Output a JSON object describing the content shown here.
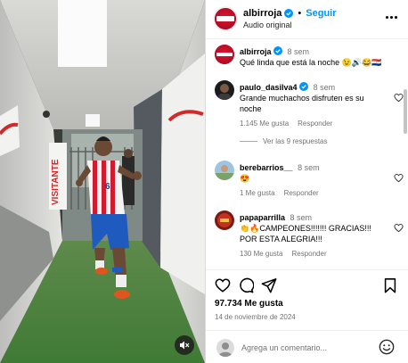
{
  "colors": {
    "accent": "#0095f6",
    "brand": "#c8102e",
    "muted": "#737373"
  },
  "header": {
    "username": "albirroja",
    "follow_label": "Seguir",
    "subtitle": "Audio original",
    "more_icon": "more-horizontal-icon"
  },
  "caption": {
    "username": "albirroja",
    "time": "8 sem",
    "text": "Qué linda que está la noche 😉🔊😂🇵🇾"
  },
  "comments": [
    {
      "username": "paulo_dasilva4",
      "time": "8 sem",
      "text": "Grande muchachos disfruten es su noche",
      "likes": "1.145 Me gusta",
      "reply_label": "Responder"
    },
    {
      "username": "berebarrios__",
      "time": "8 sem",
      "text": "😍",
      "likes": "1 Me gusta",
      "reply_label": "Responder"
    },
    {
      "username": "papaparrilla",
      "time": "8 sem",
      "text": "👏🔥CAMPEONES!!!!!!! GRACIAS!!! POR ESTA ALEGRIA!!!",
      "likes": "130 Me gusta",
      "reply_label": "Responder"
    }
  ],
  "view_replies": "Ver las 9 respuestas",
  "actions": {
    "likes": "97.734 Me gusta",
    "date": "14 de noviembre de 2024"
  },
  "add_comment": {
    "placeholder": "Agrega un comentario..."
  },
  "media": {
    "banner_text": "VISITANTE",
    "jersey_number": "6"
  }
}
